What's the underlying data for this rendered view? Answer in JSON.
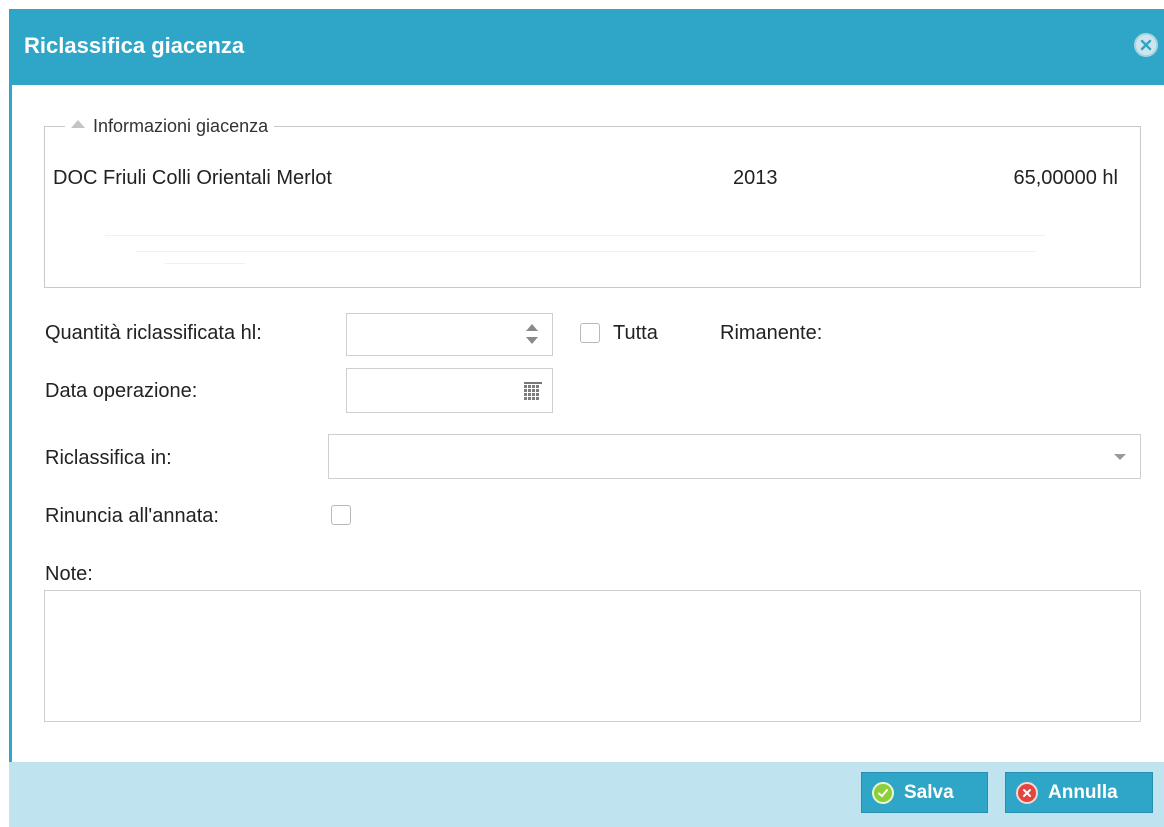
{
  "dialog": {
    "title": "Riclassifica giacenza",
    "accent_color": "#2fa6c7",
    "close_icon": "close-circle-icon"
  },
  "info": {
    "legend": "Informazioni giacenza",
    "product": "DOC Friuli Colli Orientali Merlot",
    "year": "2013",
    "quantity": "65,00000 hl"
  },
  "form": {
    "quantity_label": "Quantità riclassificata hl:",
    "quantity_value": "",
    "all_label": "Tutta",
    "remaining_label": "Rimanente:",
    "date_label": "Data operazione:",
    "date_value": "",
    "reclassify_label": "Riclassifica in:",
    "reclassify_value": "",
    "waive_year_label": "Rinuncia all'annata:",
    "notes_label": "Note:",
    "notes_value": ""
  },
  "footer": {
    "save_label": "Salva",
    "cancel_label": "Annulla",
    "save_icon": "check-circle-icon",
    "cancel_icon": "x-circle-icon"
  }
}
